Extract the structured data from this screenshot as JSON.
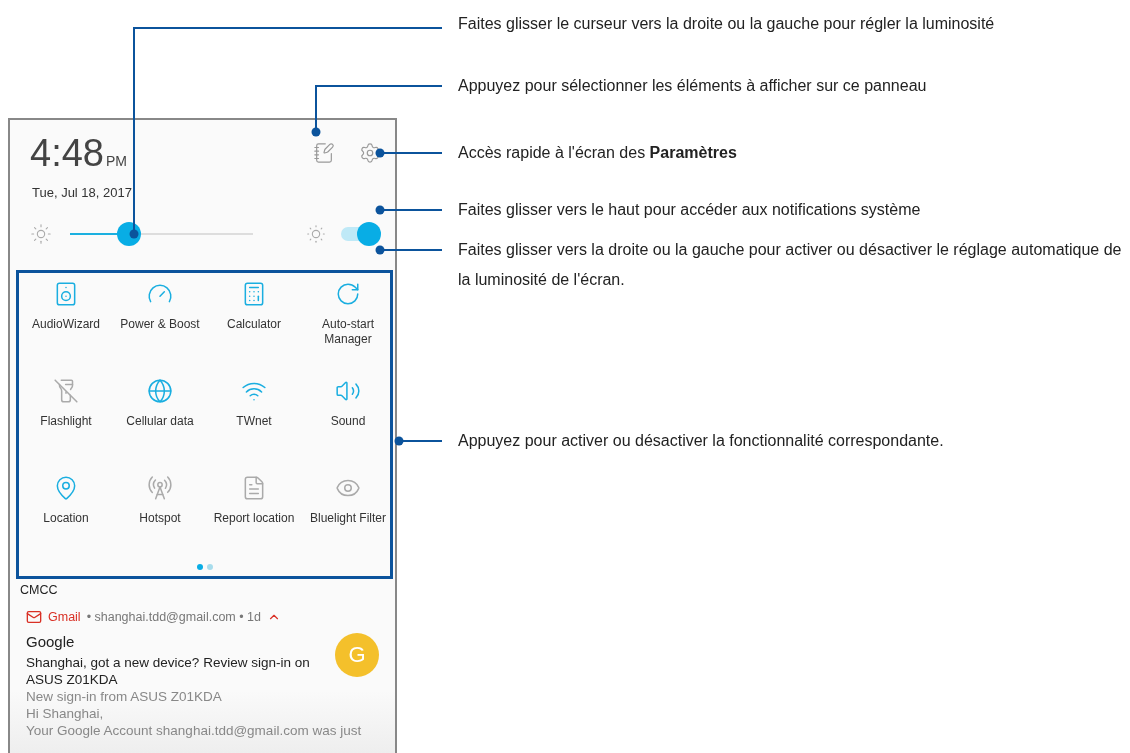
{
  "clock": {
    "time": "4:48",
    "ampm": "PM",
    "date": "Tue, Jul 18, 2017"
  },
  "brightness": {
    "level": 0.32,
    "auto": true
  },
  "tiles": [
    {
      "label": "AudioWizard",
      "on": true
    },
    {
      "label": "Power & Boost",
      "on": true
    },
    {
      "label": "Calculator",
      "on": true
    },
    {
      "label": "Auto-start Manager",
      "on": true
    },
    {
      "label": "Flashlight",
      "on": false
    },
    {
      "label": "Cellular data",
      "on": true
    },
    {
      "label": "TWnet",
      "on": true
    },
    {
      "label": "Sound",
      "on": true
    },
    {
      "label": "Location",
      "on": true
    },
    {
      "label": "Hotspot",
      "on": false
    },
    {
      "label": "Report location",
      "on": false
    },
    {
      "label": "Bluelight Filter",
      "on": false
    }
  ],
  "pager": [
    {
      "selected": true
    },
    {
      "selected": false
    }
  ],
  "carrier": "CMCC",
  "notification": {
    "app": "Gmail",
    "meta": "• shanghai.tdd@gmail.com • 1d",
    "expanded": true,
    "avatar": "G",
    "title": "Google",
    "subject": "Shanghai, got a new device? Review sign-in on ASUS Z01KDA",
    "lines": [
      "New sign-in from ASUS Z01KDA",
      "Hi Shanghai,",
      "Your Google Account shanghai.tdd@gmail.com was just"
    ]
  },
  "callouts": [
    {
      "text": "Faites glisser le curseur vers la droite ou la gauche pour régler la luminosité"
    },
    {
      "text": "Appuyez pour sélectionner les éléments à afficher sur ce panneau"
    },
    {
      "text": "Accès rapide à l'écran des **Paramètres**"
    },
    {
      "text": "Faites glisser vers le haut pour accéder aux notifications système"
    },
    {
      "text": "Faites glisser vers la droite ou la gauche pour activer ou désactiver le réglage automatique de la luminosité de l'écran."
    },
    {
      "text": "Appuyez pour activer ou désactiver la fonctionnalité correspondante."
    }
  ]
}
